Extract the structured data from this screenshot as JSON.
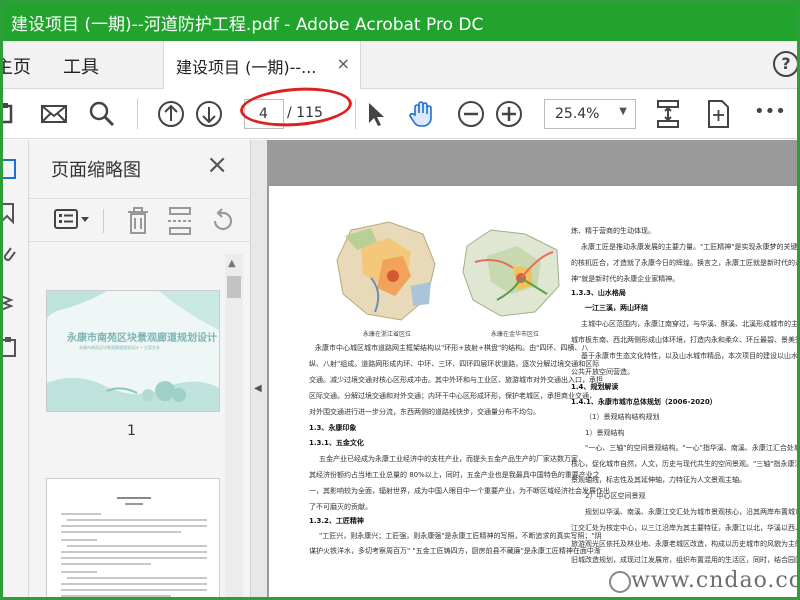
{
  "titlebar": {
    "title": "建设项目 (一期)--河道防护工程.pdf - Adobe Acrobat Pro DC"
  },
  "tabbar": {
    "home": "主页",
    "tools": "工具",
    "doc_tab": "建设项目 (一期)--...",
    "close": "×",
    "help": "?"
  },
  "toolbar": {
    "page_current": "4",
    "page_total": "/ 115",
    "zoom": "25.4%",
    "more": "•••"
  },
  "panel": {
    "title": "页面缩略图",
    "close": "×",
    "thumb1_title": "永康市南苑区块景观廊道规划设计",
    "thumb1_sub": "永康市南苑区块景观廊道规划设计 • 方案文本",
    "thumb1_number": "1"
  },
  "document": {
    "left": {
      "map_cap1": "永康在浙江省区位",
      "map_cap2": "永康在金华市区位",
      "p1": "永康市中心城区城市道路网主框架结构以\"环形+放射+棋盘\"的结构。由\"四环、四横、八",
      "p2": "纵、八射\"组成。道路网形成内环、中环、三环、四环四层环状道路，逐次分解过境交通和区际",
      "p3": "交通。减少过境交通对核心区形成冲击。其中外环和与工业区、旅游城市对外交通出入口，承担",
      "p4": "区际交通。分解过境交通和对外交通；内环干中心区形成环形，保护老城区，承担商业交通，",
      "p5": "对外围交通进行进一步分流，东西两侧的道路线快步，交通量分布不均匀。",
      "h1": "1.3、永康印象",
      "h2": "1.3.1、五金文化",
      "p6": "五金产业已经成为永康工业经济中的支柱产业，而提头五金产品生产的厂家达数万家，",
      "p7": "其经济份额约占当地工业总量的 80%以上，同时，五金产业也是我最具中国特色的重要产业之",
      "p8": "一，其影响较为全面，辐射世界，成为中国人眼目中一个重要产业，为不断区域经济社会发展作出",
      "p9": "了不可磨灭的贡献。",
      "h3": "1.3.2、工匠精神",
      "p10": "\"工匠兴，则永康兴；工匠强，则永康强\"是永康工匠精神的写照，不断追求的真实写照；\"阴",
      "p11": "谋护火铁洋水，多切考察周百万\" \"五金工匠铸四方，厨房前县不藏廉\"是永康工匠精神在面中渐"
    },
    "right": {
      "r1": "炼、精于营商的生动体现。",
      "r2": "永康工匠是推动永康发展的主要力量。\"工匠精神\"是实现永康梦的关键因素。正",
      "r3": "的核机匠合，才造就了永康今日的辉煌。换言之，永康工匠就是新时代的永康企业家。\"工",
      "r4": "神\"就是新时代的永康企业家精神。",
      "h1": "1.3.3、山水格局",
      "h1b": "一江三溪，两山环绕",
      "r5": "主城中心区范围内，永康江南穿过，与华溪、酥溪、北溪形成城市的主要水系网络。",
      "r6": "城市板东南、西北两侧形成山体环境，打造内永和柔众、环丘最碧、景美秀的的建筑环境。",
      "r7": "基于永康市生态文化特性，以及山水城市精品，本次项目的建设以山水生态为主导进行",
      "r8": "公共开放空间营造。",
      "h2": "1.4、规划解读",
      "h3": "1.4.1、永康市城市总体规划（2006-2020）",
      "r9": "（1）景观结构结构规划",
      "r10": "1）景观结构",
      "r11": "\"一心、三轴\"的空间景观结构。\"一心\"指华溪、南溪、永康江汇合处城市中心区",
      "r12": "核心，促化城市自然，人文，历史与现代共生的空间景观。\"三轴\"指永康江、南溪滨河景观",
      "r13": "景观轴线，标志性及其延伸轴，力特征为人文景观主轴。",
      "r14": "2）中心区空间景观",
      "r15": "规划以华溪、南溪、永康江交汇处为城市景观核心，沿其两岸布置城市大型公共设施。",
      "r16": "江交汇处为核定中心，以三江沿岸为其主要特征，永康江以北，华溪以西、华溪以西，以科技研发为核心",
      "r17": "旅游观光区依托及林业地、永康老城区改造，构成以历史城市的风貌为主的景观，永康江以南，",
      "r18": "旧城改造规划，成现过江发展帘，组织布置混用的生活区，同时，结合园区的空间及其景观，"
    }
  },
  "watermark": "www.cndao.com"
}
